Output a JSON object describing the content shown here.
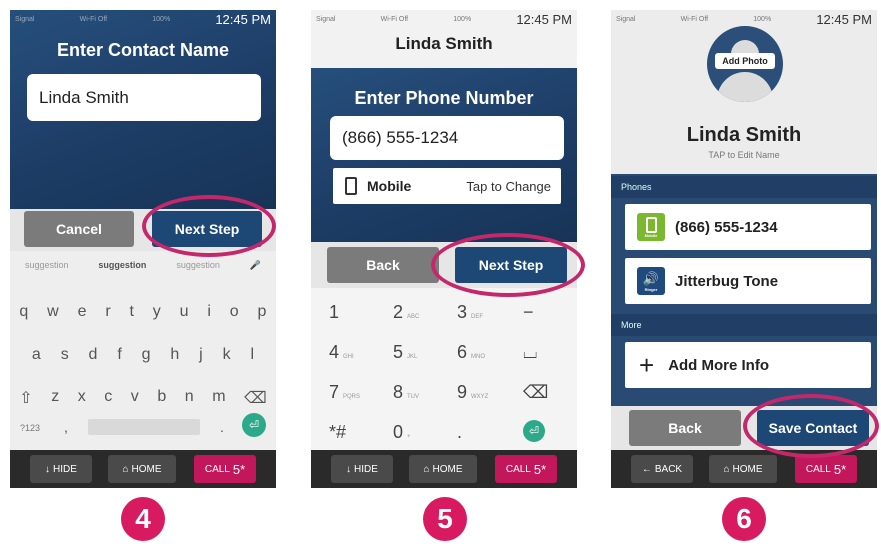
{
  "status": {
    "signal": "Signal",
    "wifi": "Wi-Fi Off",
    "battery": "100%",
    "time": "12:45 PM"
  },
  "screen4": {
    "title": "Enter Contact Name",
    "name_value": "Linda Smith",
    "cancel": "Cancel",
    "next": "Next Step",
    "suggestions": [
      "suggestion",
      "suggestion",
      "suggestion"
    ],
    "row1": [
      "q",
      "w",
      "e",
      "r",
      "t",
      "y",
      "u",
      "i",
      "o",
      "p"
    ],
    "row2": [
      "a",
      "s",
      "d",
      "f",
      "g",
      "h",
      "j",
      "k",
      "l"
    ],
    "row3": [
      "z",
      "x",
      "c",
      "v",
      "b",
      "n",
      "m"
    ],
    "sym": "?123",
    "comma": ",",
    "dot": "."
  },
  "screen5": {
    "header": "Linda Smith",
    "title": "Enter Phone Number",
    "phone_value": "(866) 555-1234",
    "type": "Mobile",
    "tap_change": "Tap to Change",
    "back": "Back",
    "next": "Next Step",
    "keys": [
      {
        "d": "1",
        "l": ""
      },
      {
        "d": "2",
        "l": "ABC"
      },
      {
        "d": "3",
        "l": "DEF"
      },
      {
        "d": "−",
        "l": ""
      },
      {
        "d": "4",
        "l": "GHI"
      },
      {
        "d": "5",
        "l": "JKL"
      },
      {
        "d": "6",
        "l": "MNO"
      },
      {
        "d": "⌴",
        "l": ""
      },
      {
        "d": "7",
        "l": "PQRS"
      },
      {
        "d": "8",
        "l": "TUV"
      },
      {
        "d": "9",
        "l": "WXYZ"
      },
      {
        "d": "⌫",
        "l": ""
      },
      {
        "d": "*#",
        "l": ""
      },
      {
        "d": "0",
        "l": "+"
      },
      {
        "d": ".",
        "l": ""
      },
      {
        "d": "⏎",
        "l": ""
      }
    ]
  },
  "screen6": {
    "add_photo": "Add Photo",
    "name": "Linda Smith",
    "tap_edit": "TAP to Edit Name",
    "phones_label": "Phones",
    "phone": "(866) 555-1234",
    "mobile_tag": "Mobile",
    "ringer": "Jitterbug Tone",
    "ringer_tag": "Ringer",
    "more_label": "More",
    "add_more": "Add More Info",
    "back": "Back",
    "save": "Save Contact"
  },
  "sysbar": {
    "hide": "HIDE",
    "home": "HOME",
    "call": "CALL",
    "back": "BACK",
    "five": "5*"
  },
  "steps": [
    "4",
    "5",
    "6"
  ],
  "colors": {
    "accent": "#d81b60",
    "navy": "#1f3f67",
    "button_blue": "#1d4775"
  }
}
